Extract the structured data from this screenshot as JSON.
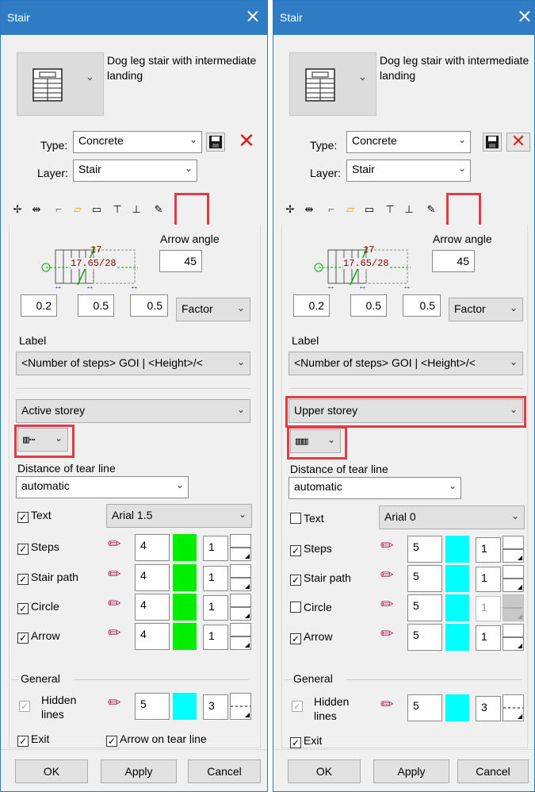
{
  "left": {
    "title": "Stair",
    "close_icon": "×",
    "description": "Dog leg stair with intermediate landing",
    "type_label": "Type:",
    "type_value": "Concrete",
    "layer_label": "Layer:",
    "layer_value": "Stair",
    "arrow_angle_label": "Arrow angle",
    "arrow_angle_value": "45",
    "diagram_steps": "17",
    "diagram_dims": "17.65/28",
    "dim1": "0.2",
    "dim2": "0.5",
    "dim3": "0.5",
    "factor": "Factor",
    "label_heading": "Label",
    "label_value": "<Number of steps> GOI | <Height>/<",
    "storey": "Active storey",
    "tear_line_heading": "Distance of tear line",
    "tear_line_value": "automatic",
    "rows": [
      {
        "label": "Text",
        "checked": true,
        "font": "Arial 1.5"
      },
      {
        "label": "Steps",
        "checked": true,
        "pen": "4",
        "color": "#00ee00",
        "line": "1"
      },
      {
        "label": "Stair path",
        "checked": true,
        "pen": "4",
        "color": "#00ee00",
        "line": "1"
      },
      {
        "label": "Circle",
        "checked": true,
        "pen": "4",
        "color": "#00ee00",
        "line": "1"
      },
      {
        "label": "Arrow",
        "checked": true,
        "pen": "4",
        "color": "#00ee00",
        "line": "1"
      }
    ],
    "general_heading": "General",
    "hidden_lines_label": "Hidden lines",
    "hidden_pen": "5",
    "hidden_color": "#00ffff",
    "hidden_line": "3",
    "exit_label": "Exit",
    "arrow_tear_label": "Arrow on tear line",
    "ok": "OK",
    "apply": "Apply",
    "cancel": "Cancel"
  },
  "right": {
    "title": "Stair",
    "close_icon": "×",
    "description": "Dog leg stair with intermediate landing",
    "type_label": "Type:",
    "type_value": "Concrete",
    "layer_label": "Layer:",
    "layer_value": "Stair",
    "arrow_angle_label": "Arrow angle",
    "arrow_angle_value": "45",
    "diagram_steps": "17",
    "diagram_dims": "17.65/28",
    "dim1": "0.2",
    "dim2": "0.5",
    "dim3": "0.5",
    "factor": "Factor",
    "label_heading": "Label",
    "label_value": "<Number of steps> GOI | <Height>/<",
    "storey": "Upper storey",
    "tear_line_heading": "Distance of tear line",
    "tear_line_value": "automatic",
    "rows": [
      {
        "label": "Text",
        "checked": false,
        "font": "Arial 0"
      },
      {
        "label": "Steps",
        "checked": true,
        "pen": "5",
        "color": "#00ffff",
        "line": "1"
      },
      {
        "label": "Stair path",
        "checked": true,
        "pen": "5",
        "color": "#00ffff",
        "line": "1"
      },
      {
        "label": "Circle",
        "checked": false,
        "pen": "5",
        "color": "#00ffff",
        "line": "1"
      },
      {
        "label": "Arrow",
        "checked": true,
        "pen": "5",
        "color": "#00ffff",
        "line": "1"
      }
    ],
    "general_heading": "General",
    "hidden_lines_label": "Hidden lines",
    "hidden_pen": "5",
    "hidden_color": "#00ffff",
    "hidden_line": "3",
    "exit_label": "Exit",
    "ok": "OK",
    "apply": "Apply",
    "cancel": "Cancel"
  },
  "icons": {
    "save": "floppy-disk-icon",
    "delete": "red-x-icon",
    "pen": "colored-pencil-icon"
  },
  "colors": {
    "titlebar": "#2f7cc4",
    "highlight": "#e23b46"
  }
}
